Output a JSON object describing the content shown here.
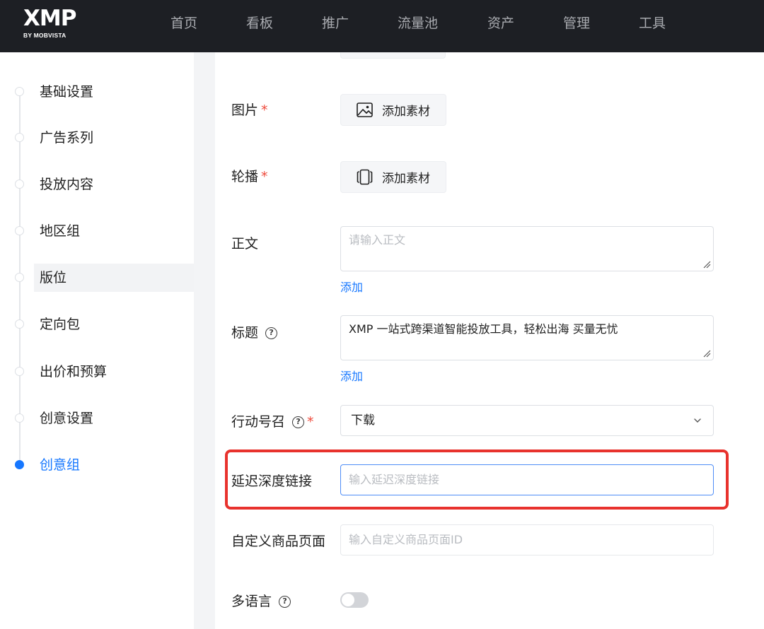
{
  "header": {
    "logo_text": "XMP",
    "logo_subtitle": "BY MOBVISTA",
    "nav": [
      "首页",
      "看板",
      "推广",
      "流量池",
      "资产",
      "管理",
      "工具"
    ]
  },
  "sidebar": {
    "steps": [
      {
        "label": "基础设置"
      },
      {
        "label": "广告系列"
      },
      {
        "label": "投放内容"
      },
      {
        "label": "地区组"
      },
      {
        "label": "版位"
      },
      {
        "label": "定向包"
      },
      {
        "label": "出价和预算"
      },
      {
        "label": "创意设置"
      },
      {
        "label": "创意组"
      }
    ],
    "highlighted_step": "版位",
    "active_step": "创意组"
  },
  "form": {
    "image": {
      "label": "图片",
      "required_mark": "*",
      "button_label": "添加素材",
      "icon": "image-icon"
    },
    "carousel": {
      "label": "轮播",
      "required_mark": "*",
      "button_label": "添加素材",
      "icon": "carousel-icon"
    },
    "body": {
      "label": "正文",
      "placeholder": "请输入正文",
      "add_link": "添加"
    },
    "title": {
      "label": "标题",
      "help": "?",
      "value": "XMP 一站式跨渠道智能投放工具，轻松出海  买量无忧",
      "add_link": "添加"
    },
    "cta": {
      "label": "行动号召",
      "help": "?",
      "required_mark": "*",
      "value": "下载"
    },
    "deferred_deeplink": {
      "label": "延迟深度链接",
      "placeholder": "输入延迟深度链接"
    },
    "custom_product_page": {
      "label": "自定义商品页面",
      "placeholder": "输入自定义商品页面ID"
    },
    "multilang": {
      "label": "多语言",
      "help": "?",
      "enabled": false
    }
  },
  "colors": {
    "topbar": "#1d1f24",
    "accent": "#1677ff",
    "required": "#ee4a3c",
    "annotation_box": "#e8322d"
  }
}
